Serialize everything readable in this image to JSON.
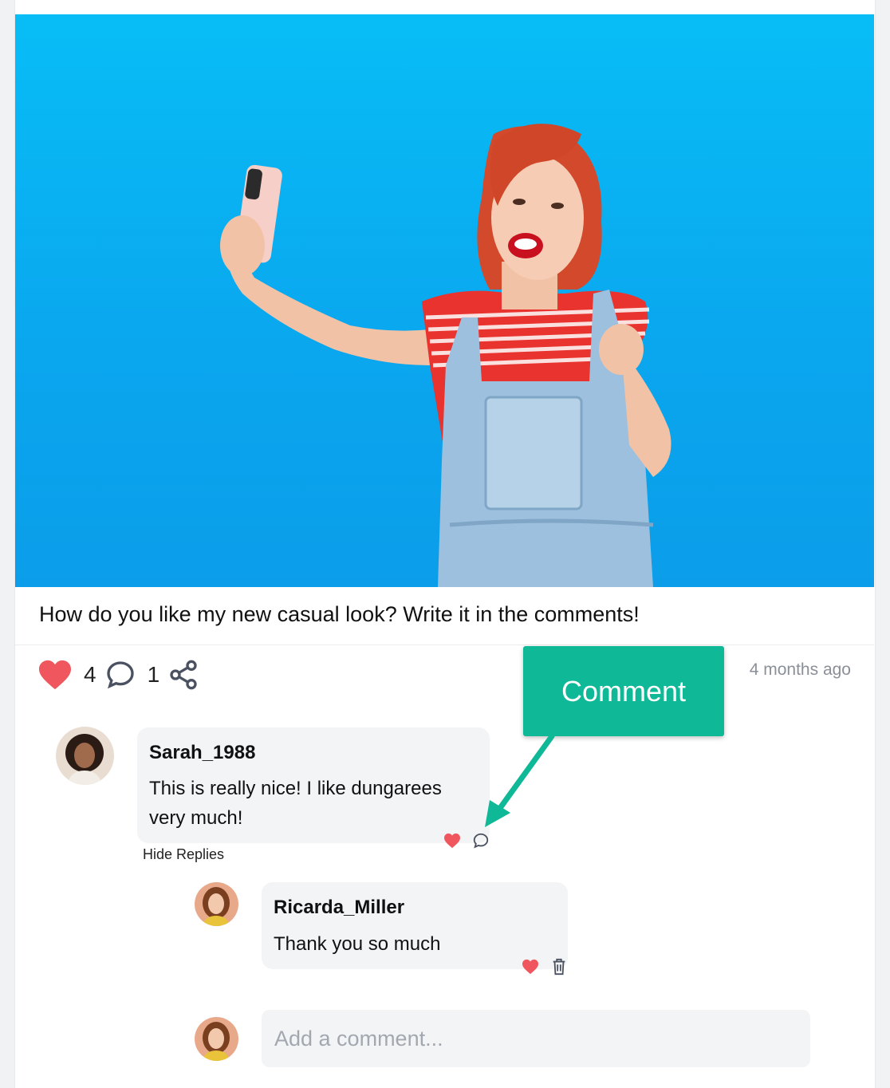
{
  "post": {
    "caption": "How do you like my new casual look? Write it in the comments!",
    "like_count": "4",
    "comment_count": "1",
    "time_ago": "4 months ago"
  },
  "comments": [
    {
      "username": "Sarah_1988",
      "text_line1": "This is really nice! I like dungarees",
      "text_line2": "very much!",
      "hide_replies_label": "Hide Replies"
    }
  ],
  "replies": [
    {
      "username": "Ricarda_Miller",
      "text": "Thank you so much"
    }
  ],
  "composer": {
    "placeholder": "Add a comment..."
  },
  "tooltip": {
    "label": "Comment"
  },
  "colors": {
    "heart": "#f0565d",
    "accent_tooltip": "#0fb896",
    "photo_bg": "#0aa6ee",
    "bubble_bg": "#f3f4f6"
  },
  "icons": [
    "heart-icon",
    "comment-icon",
    "share-icon",
    "trash-icon",
    "arrow-icon"
  ]
}
